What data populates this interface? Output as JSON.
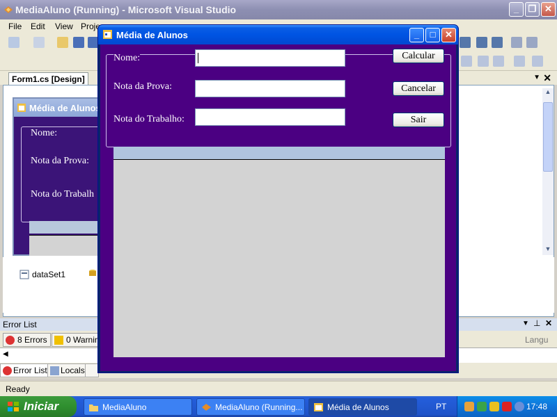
{
  "vs": {
    "title": "MediaAluno (Running) - Microsoft Visual Studio",
    "menu": [
      "File",
      "Edit",
      "View",
      "Proje"
    ],
    "doc_tab": "Form1.cs [Design]",
    "design_form": {
      "title": "Média de Alunos",
      "labels": [
        "Nome:",
        "Nota da Prova:",
        "Nota do Trabalh"
      ]
    },
    "tray_items": [
      "dataSet1"
    ],
    "error_list": {
      "title": "Error List",
      "errors": "8 Errors",
      "warnings": "0 Warnin",
      "lang_col": "Langu"
    },
    "bottom_tabs": [
      "Error List",
      "Locals"
    ],
    "status": "Ready"
  },
  "app": {
    "title": "Média de Alunos",
    "labels": {
      "nome": "Nome:",
      "prova": "Nota da Prova:",
      "trabalho": "Nota do Trabalho:"
    },
    "inputs": {
      "nome": "",
      "prova": "",
      "trabalho": ""
    },
    "buttons": {
      "calcular": "Calcular",
      "cancelar": "Cancelar",
      "sair": "Sair"
    },
    "colors": {
      "client_bg": "#4b0082",
      "grid_header": "#b0c4de",
      "grid_body": "#d3d3d3"
    }
  },
  "taskbar": {
    "start": "Iniciar",
    "tasks": [
      "MediaAluno",
      "MediaAluno (Running...",
      "Média de Alunos"
    ],
    "lang": "PT",
    "clock": "17:48"
  }
}
